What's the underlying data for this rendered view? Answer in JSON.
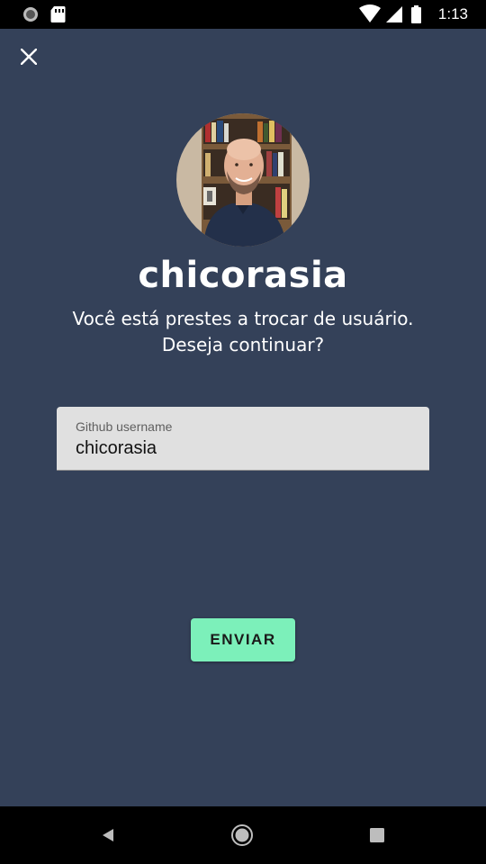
{
  "status_bar": {
    "time": "1:13",
    "icons": [
      "sync-icon",
      "sd-card-icon",
      "wifi-icon",
      "signal-icon",
      "battery-icon"
    ]
  },
  "toolbar": {
    "close_icon": "close-icon"
  },
  "profile": {
    "username": "chicorasia",
    "message_line1": "Você está prestes a trocar de usuário.",
    "message_line2": "Deseja continuar?"
  },
  "form": {
    "username_field": {
      "label": "Github username",
      "value": "chicorasia"
    },
    "submit_label": "ENVIAR"
  },
  "nav_bar": {
    "icons": [
      "back-icon",
      "home-icon",
      "recents-icon"
    ]
  },
  "colors": {
    "background": "#344159",
    "button": "#7cf0ba",
    "field": "#e0e0e0"
  }
}
